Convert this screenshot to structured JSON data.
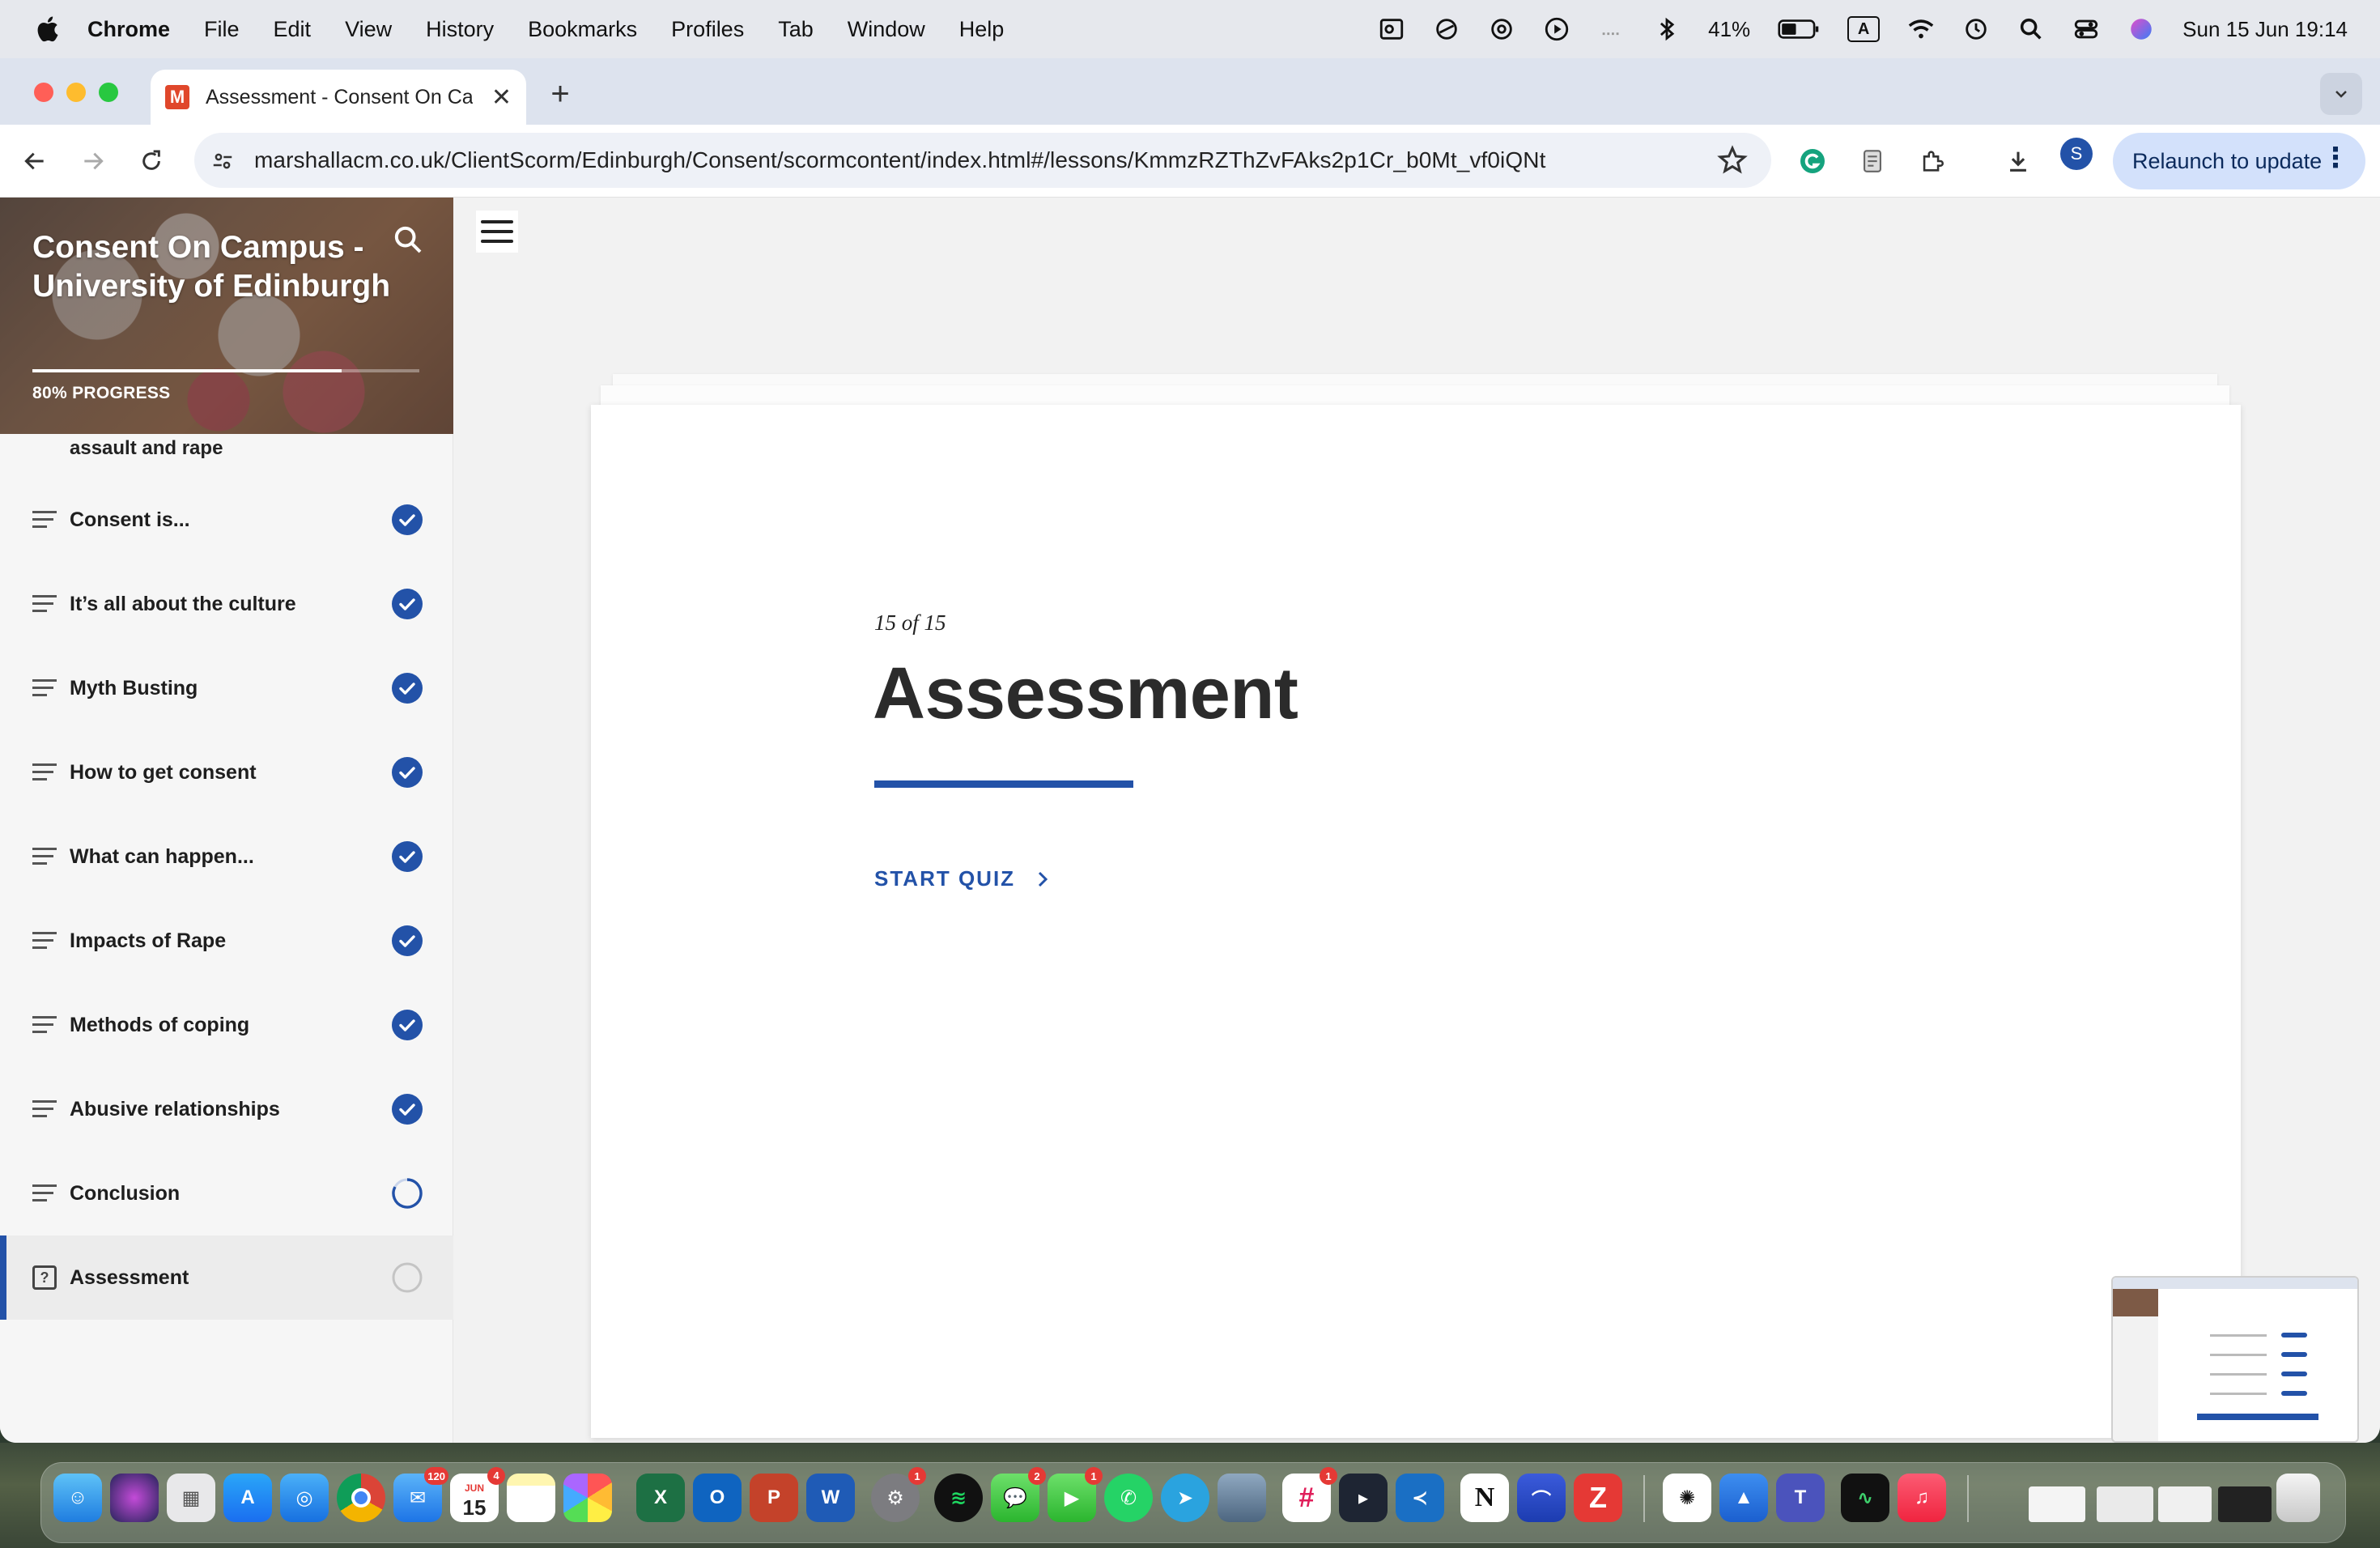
{
  "menubar": {
    "app_name": "Chrome",
    "items": [
      "File",
      "Edit",
      "View",
      "History",
      "Bookmarks",
      "Profiles",
      "Tab",
      "Window",
      "Help"
    ],
    "battery": "41%",
    "input_source": "A",
    "datetime": "Sun 15 Jun  19:14"
  },
  "browser": {
    "tab_title": "Assessment - Consent On Ca",
    "tab_favicon": "M",
    "url": "marshallacm.co.uk/ClientScorm/Edinburgh/Consent/scormcontent/index.html#/lessons/KmmzRZThZvFAks2p1Cr_b0Mt_vf0iQNt",
    "profile_initial": "S",
    "relaunch_label": "Relaunch to update"
  },
  "sidebar": {
    "course_title": "Consent On Campus - University of Edinburgh",
    "progress_label": "80% PROGRESS",
    "progress_fraction": 0.8,
    "partial_item": "assault and rape",
    "lessons": [
      {
        "label": "Consent is...",
        "status": "complete"
      },
      {
        "label": "It’s all about the culture",
        "status": "complete"
      },
      {
        "label": "Myth Busting",
        "status": "complete"
      },
      {
        "label": "How to get consent",
        "status": "complete"
      },
      {
        "label": "What can happen...",
        "status": "complete"
      },
      {
        "label": "Impacts of Rape",
        "status": "complete"
      },
      {
        "label": "Methods of coping",
        "status": "complete"
      },
      {
        "label": "Abusive relationships",
        "status": "complete"
      },
      {
        "label": "Conclusion",
        "status": "in-progress"
      },
      {
        "label": "Assessment",
        "status": "not-started"
      }
    ],
    "quiz_icon_glyph": "?"
  },
  "main": {
    "counter": "15 of 15",
    "title": "Assessment",
    "start_label": "START QUIZ"
  },
  "dock": {
    "mail_badge": "120",
    "calendar_month": "JUN",
    "calendar_day": "15",
    "calendar_badge": "4",
    "settings_badge": "1",
    "messages_badge": "2",
    "facetime_badge": "1",
    "slack_badge": "1"
  },
  "colors": {
    "accent": "#2352a8",
    "menubar_bg": "#e6e8ed",
    "tabstrip_bg": "#dde3ee"
  }
}
